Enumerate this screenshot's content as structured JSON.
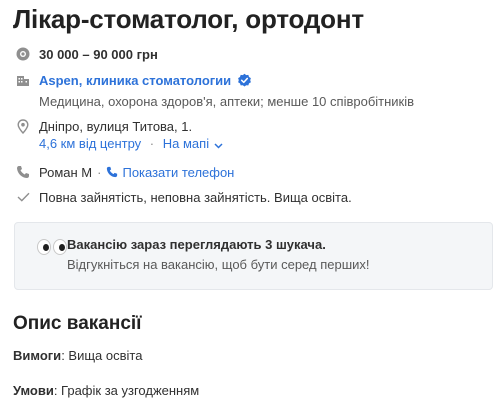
{
  "vacancy": {
    "title": "Лікар-стоматолог, ортодонт",
    "salary": "30 000 – 90 000 грн",
    "company_name": "Aspen, клиника стоматологии",
    "company_details": "Медицина, охорона здоров'я, аптеки; менше 10 співробітників",
    "address": "Дніпро, вулиця Титова, 1.",
    "distance": "4,6 км від центру",
    "separator": "·",
    "map_link": "На мапі",
    "contact_name": "Роман М",
    "show_phone": "Показати телефон",
    "employment": "Повна зайнятість, неповна зайнятість. Вища освіта."
  },
  "notice": {
    "title": "Вакансію зараз переглядають 3 шукача.",
    "text": "Відгукніться на вакансію, щоб бути серед перших!"
  },
  "description": {
    "title": "Опис вакансії",
    "requirements_label": "Вимоги",
    "requirements_value": ": Вища освіта",
    "conditions_label": "Умови",
    "conditions_value": ": Графік за узгодженням"
  },
  "colors": {
    "link": "#2d72d9",
    "text": "#303030",
    "muted": "#595959",
    "notice_bg": "#f4f6f8"
  },
  "icons": [
    "salary-icon",
    "building-icon",
    "verified-icon",
    "location-pin-icon",
    "chevron-down-icon",
    "phone-icon",
    "check-icon",
    "eyes-icon"
  ]
}
